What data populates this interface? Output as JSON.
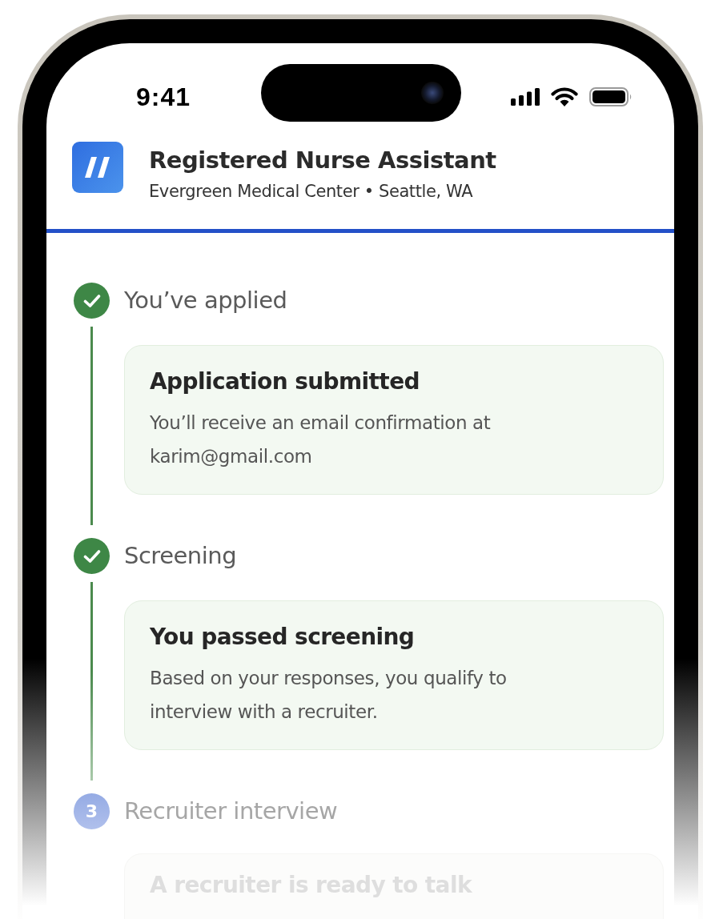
{
  "status_bar": {
    "time": "9:41"
  },
  "job": {
    "title": "Registered Nurse Assistant",
    "subtitle": "Evergreen Medical Center • Seattle, WA"
  },
  "steps": [
    {
      "label": "You’ve applied",
      "completed": true,
      "card": {
        "title": "Application submitted",
        "text": "You’ll receive an email confirmation at karim@gmail.com"
      }
    },
    {
      "label": "Screening",
      "completed": true,
      "card": {
        "title": "You passed screening",
        "text": "Based on your responses, you qualify to interview with a recruiter."
      }
    },
    {
      "label": "Recruiter interview",
      "completed": false,
      "number": "3",
      "card": {
        "title": "A recruiter is ready to talk"
      }
    }
  ]
}
